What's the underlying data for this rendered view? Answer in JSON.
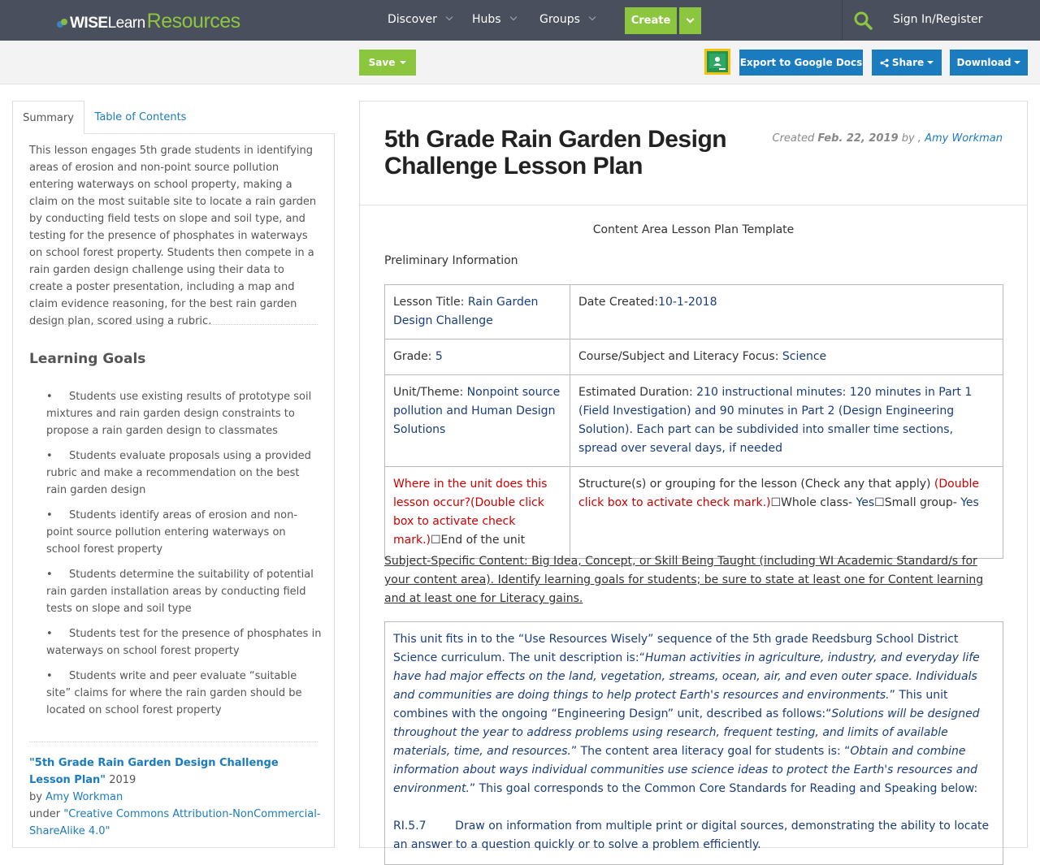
{
  "nav": {
    "logo": {
      "part1": "WISE",
      "part2": "Learn",
      "part3": "Resources"
    },
    "discover": "Discover",
    "hubs": "Hubs",
    "groups": "Groups",
    "create": "Create",
    "signin": "Sign In/Register"
  },
  "toolbar": {
    "save": "Save",
    "export": "Export to Google Docs",
    "share": "Share",
    "download": "Download"
  },
  "tabs": {
    "summary": "Summary",
    "toc": "Table of Contents"
  },
  "summary": "This lesson engages 5th grade students in identifying areas of erosion and non-point source pollution entering waterways on school property, making a claim on the most suitable site to locate a rain garden by conducting field tests on slope and soil type, and testing for the presence of phosphates in waterways on school forest property. Students then compete in a rain garden design challenge using their data to create a poster presentation, including a map and claim evidence reasoning, for the best rain garden design plan, scored using a rubric.",
  "learning_goals": {
    "title": "Learning Goals",
    "items": [
      "Students use existing results of prototype soil mixtures and rain garden design constraints to propose a rain garden design to classmates",
      "Students evaluate proposals using a provided rubric and make a recommendation on the best rain garden design",
      "Students identify areas of erosion and non-point source pollution entering waterways on school forest property",
      "Students determine the suitability of potential rain garden installation areas by conducting field tests on slope and soil type",
      "Students test for the presence of phosphates in waterways on school forest property",
      "Students write and peer evaluate “suitable site” claims for where the rain garden should be located on school forest property"
    ]
  },
  "citation": {
    "title": "\"5th Grade Rain Garden Design Challenge Lesson Plan\"",
    "year": " 2019",
    "by": "by ",
    "author": "Amy Workman",
    "under": "under ",
    "license": "\"Creative Commons Attribution-NonCommercial-ShareAlike 4.0\""
  },
  "doc": {
    "title": "5th Grade Rain Garden Design Challenge Lesson Plan",
    "created_label": "Created ",
    "created_date": "Feb. 22, 2019",
    "by": " by , ",
    "author": "Amy Workman",
    "template_title": "Content Area Lesson Plan Template",
    "prelim": "Preliminary Information",
    "table": {
      "lesson_title_label": "Lesson Title: ",
      "lesson_title": "Rain Garden Design Challenge",
      "date_label": "Date Created:",
      "date": "10-1-2018",
      "grade_label": "Grade: ",
      "grade": "5",
      "course_label": "Course/Subject and Literacy Focus: ",
      "course": "Science",
      "unit_label": "Unit/Theme: ",
      "unit": "Nonpoint source pollution and Human Design Solutions",
      "duration_label": "Estimated Duration:  ",
      "duration": "210 instructional minutes: 120 minutes in Part 1 (Field Investigation) and 90 minutes in Part 2 (Design Engineering Solution). Each part can be subdivided into smaller time sections, spread over several days, if needed",
      "where_label": "Where in the unit does this lesson occur?(Double click box to activate check mark.)",
      "where_value": "☐End of the unit",
      "structure_label": "Structure(s) or grouping for the lesson (Check any that apply) ",
      "structure_red": "(Double click box to activate check mark.)",
      "whole_class": "☐Whole class- ",
      "whole_yes": "Yes",
      "small_group": "☐Small group- ",
      "small_yes": "Yes"
    },
    "subject_content": "Subject-Specific Content:  Big Idea, Concept, or Skill Being Taught (including WI Academic Standard/s for your content area). Identify learning goals for students; be sure to state at least one for Content learning and at least one for Literacy gains. ",
    "unit_text": {
      "p1": "This unit fits in to the “Use Resources Wisely” sequence of the 5th grade Reedsburg School District Science curriculum. The unit description is:“",
      "i1": "Human activities in agriculture, industry, and everyday life have had major effects on the land, vegetation, streams, ocean, air, and even outer space. Individuals and communities are doing things to help protect Earth's resources and environments.",
      "p2": "” This unit combines with the ongoing “Engineering Design” unit, described as follows:“",
      "i2": "Solutions will be designed throughout the year to address problems using research, frequent testing, and limits of available materials, time, and resources.",
      "p3": "” The content area literacy goal for students is: “",
      "i3": "Obtain and combine information about ways individual communities use science ideas to protect the Earth's resources and environment.",
      "p4": "” This goal corresponds to the Common Core Standards for Reading and Speaking below:",
      "ri": "RI.5.7        Draw on information from multiple print or digital sources, demonstrating the ability to locate an answer to a question quickly or to solve a problem efficiently."
    }
  },
  "colors": {
    "nav_bg": "#4a4f5e",
    "green": "#8cc63f",
    "blue": "#1a7bbf"
  }
}
